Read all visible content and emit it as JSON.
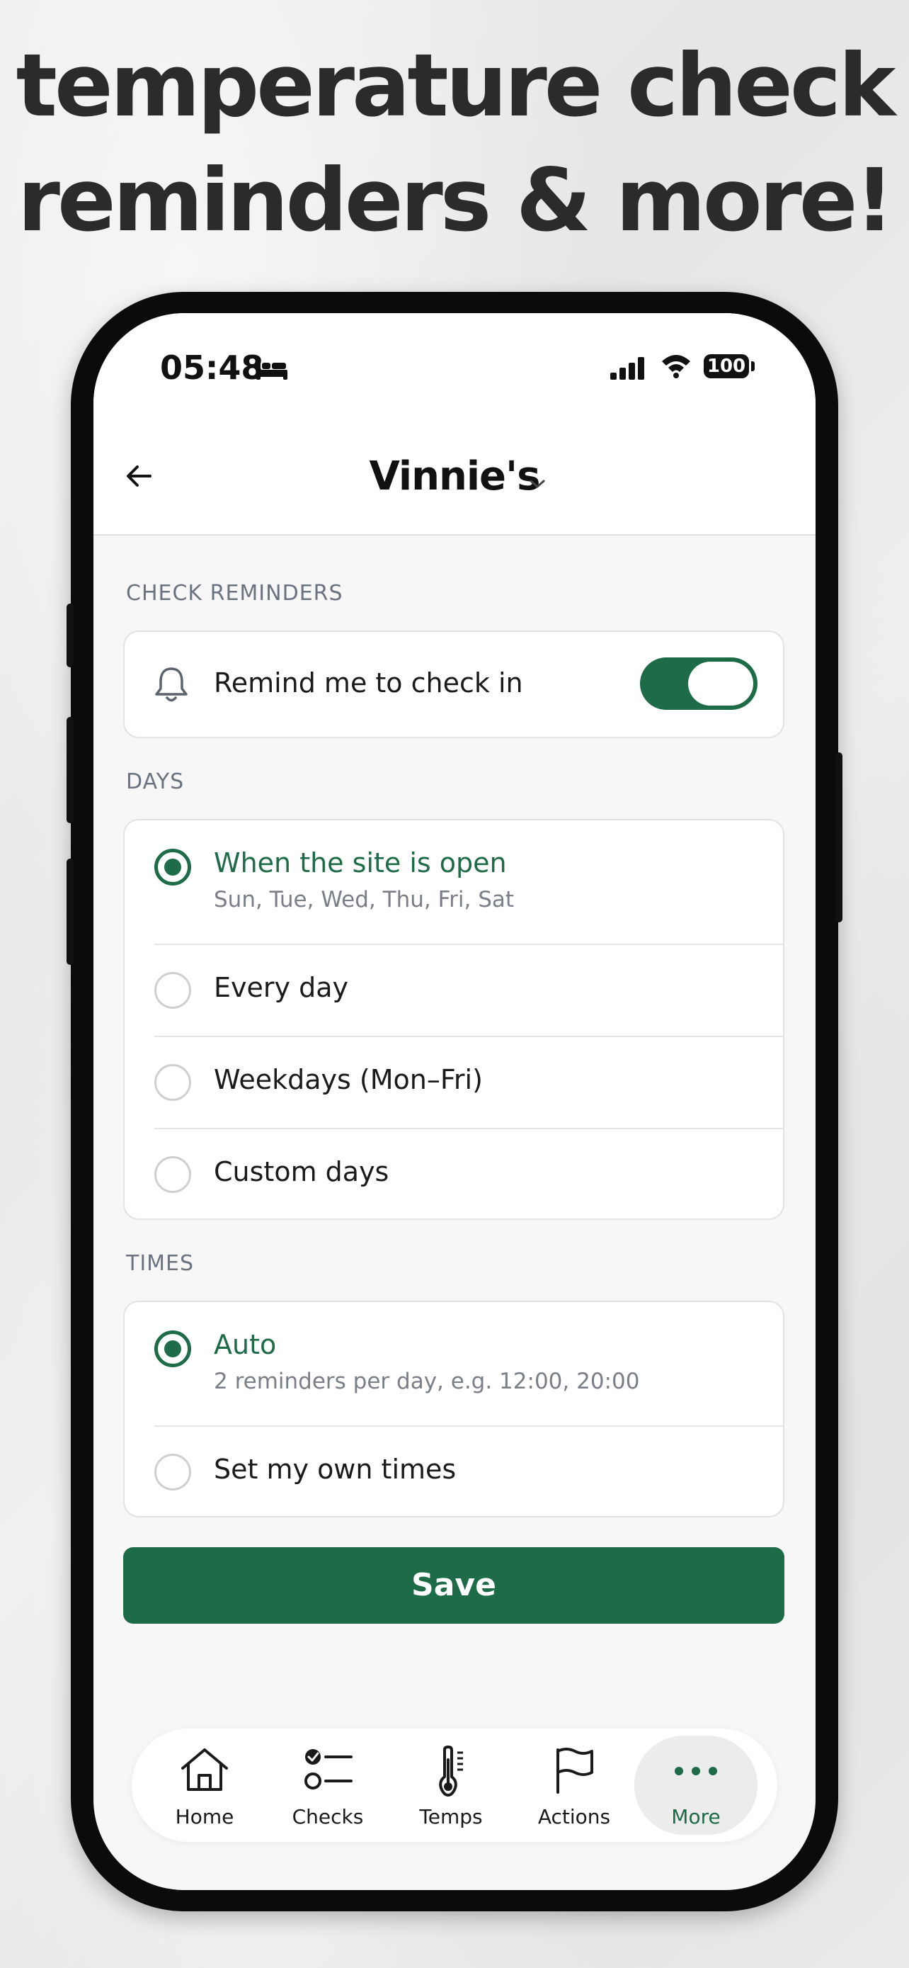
{
  "headline": {
    "line1": "temperature check",
    "line2": "reminders & more!"
  },
  "status_bar": {
    "time": "05:48",
    "battery": "100",
    "icons": [
      "bed-icon",
      "signal-icon",
      "wifi-icon",
      "battery-icon"
    ]
  },
  "header": {
    "title": "Vinnie's",
    "back_icon": "arrow-left-icon",
    "dropdown_icon": "chevron-down-icon"
  },
  "check_reminders": {
    "label": "CHECK REMINDERS",
    "toggle_label": "Remind me to check in",
    "toggle_on": true,
    "icon": "bell-icon"
  },
  "days": {
    "label": "DAYS",
    "options": [
      {
        "label": "When the site is open",
        "sub": "Sun, Tue, Wed, Thu, Fri, Sat",
        "selected": true
      },
      {
        "label": "Every day",
        "selected": false
      },
      {
        "label": "Weekdays (Mon–Fri)",
        "selected": false
      },
      {
        "label": "Custom days",
        "selected": false
      }
    ]
  },
  "times": {
    "label": "TIMES",
    "options": [
      {
        "label": "Auto",
        "sub": "2 reminders per day, e.g. 12:00, 20:00",
        "selected": true
      },
      {
        "label": "Set my own times",
        "selected": false
      }
    ]
  },
  "save_label": "Save",
  "tabs": [
    {
      "label": "Home",
      "icon": "home-icon",
      "active": false
    },
    {
      "label": "Checks",
      "icon": "checklist-icon",
      "active": false
    },
    {
      "label": "Temps",
      "icon": "thermometer-icon",
      "active": false
    },
    {
      "label": "Actions",
      "icon": "flag-icon",
      "active": false
    },
    {
      "label": "More",
      "icon": "more-dots-icon",
      "active": true
    }
  ],
  "colors": {
    "brand": "#1e6b47",
    "headline": "#2b2b2b",
    "muted": "#6b7280"
  }
}
